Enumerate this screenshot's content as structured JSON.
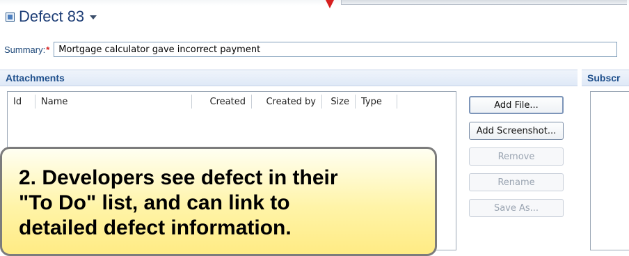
{
  "page": {
    "title": "Defect 83"
  },
  "summary": {
    "label": "Summary:",
    "required_marker": "*",
    "value": "Mortgage calculator gave incorrect payment"
  },
  "sections": {
    "attachments_title": "Attachments",
    "subscribers_title_partial": "Subscr"
  },
  "attachments_table": {
    "columns": [
      "Id",
      "Name",
      "Created",
      "Created by",
      "Size",
      "Type"
    ],
    "rows": []
  },
  "buttons": {
    "add_file": "Add File...",
    "add_screenshot": "Add Screenshot...",
    "remove": "Remove",
    "rename": "Rename",
    "save_as": "Save As..."
  },
  "callout": {
    "text": "2. Developers see defect in their\n\"To Do\" list, and can link to\ndetailed defect information."
  },
  "colors": {
    "title": "#1f3f77",
    "section_header_text": "#1e4f8c",
    "required": "#d61f1f",
    "callout_fill": "#fff4a8"
  },
  "icons": {
    "title_icon": "defect-icon",
    "title_dropdown": "chevron-down-icon",
    "top_pointer": "pointer-arrow-icon"
  }
}
